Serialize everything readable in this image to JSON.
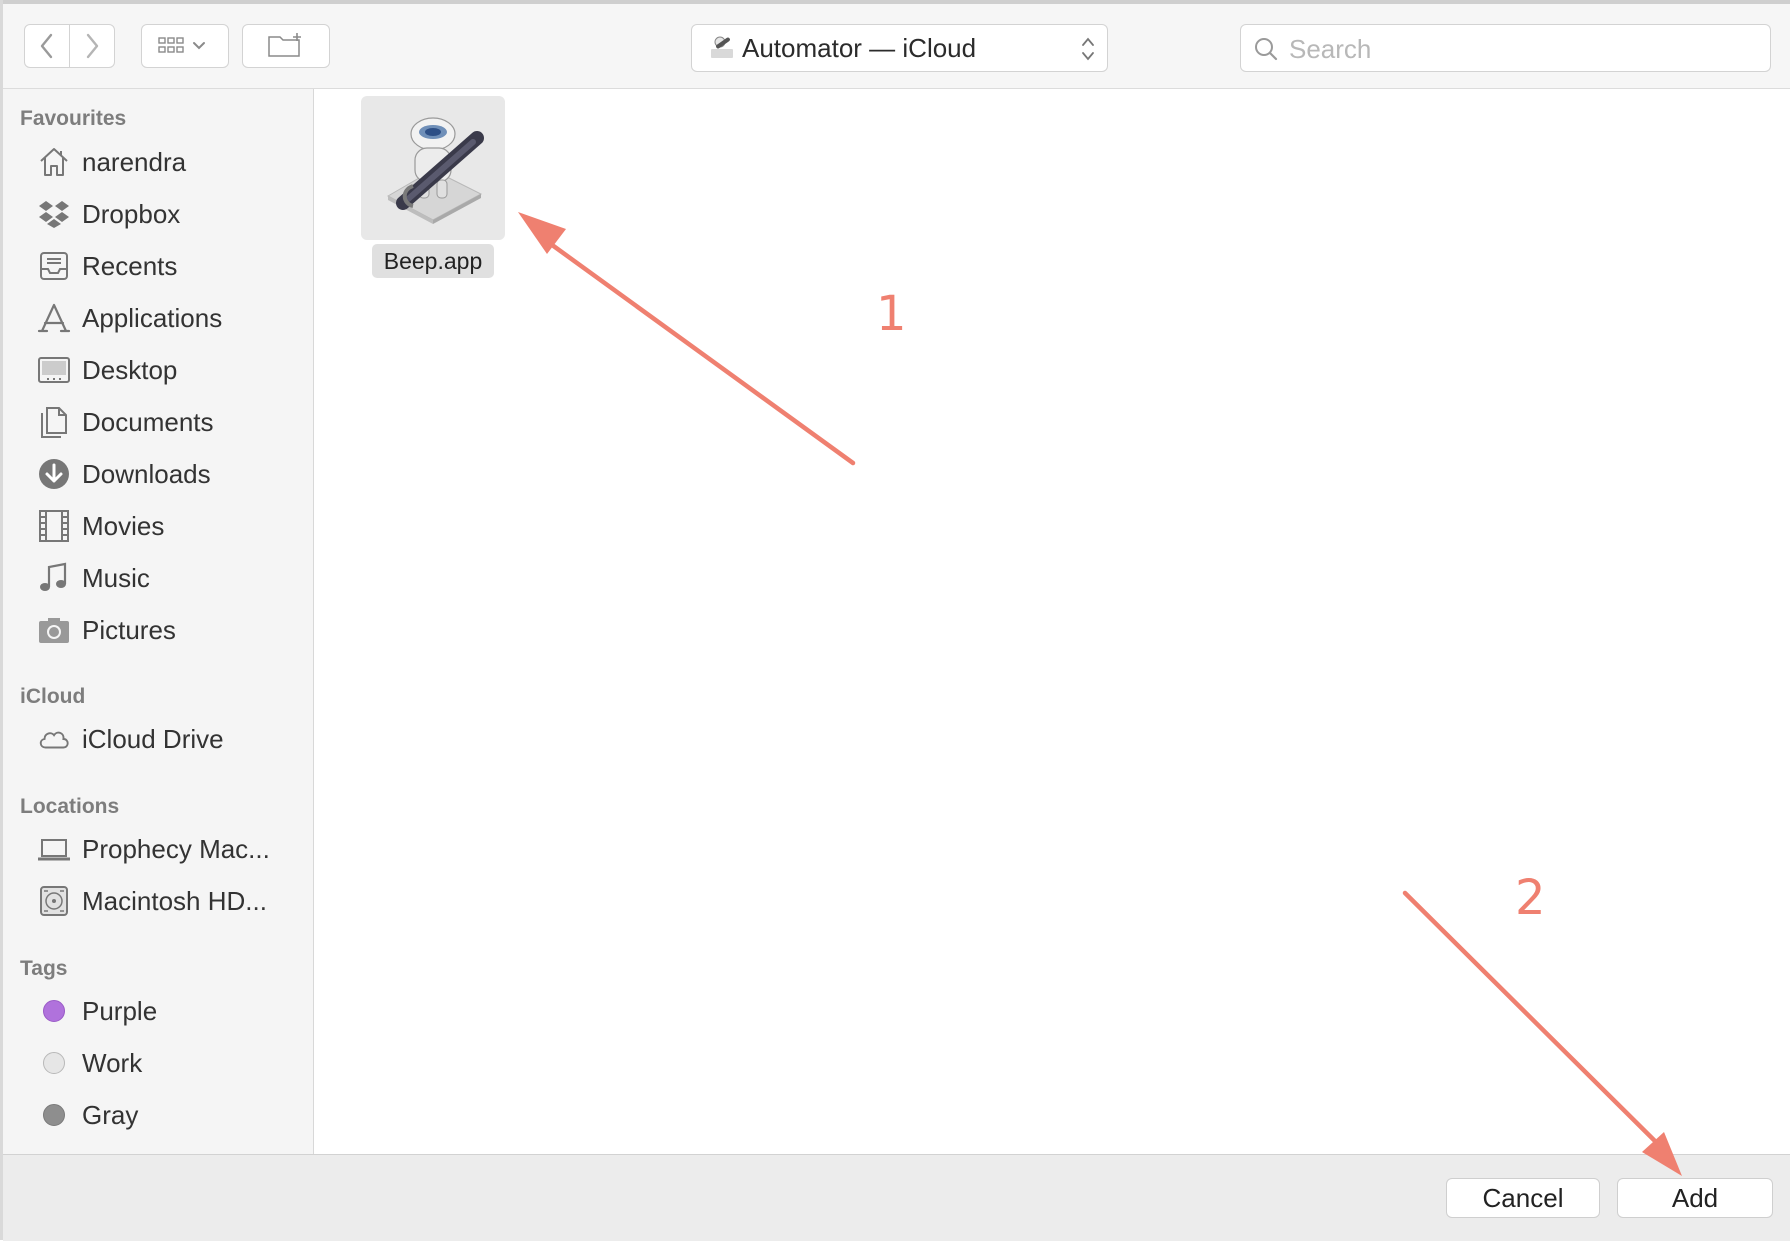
{
  "toolbar": {
    "location": "Automator — iCloud",
    "search_placeholder": "Search"
  },
  "sidebar": {
    "favourites_header": "Favourites",
    "favourites": [
      {
        "label": "narendra",
        "icon": "home-icon"
      },
      {
        "label": "Dropbox",
        "icon": "dropbox-icon"
      },
      {
        "label": "Recents",
        "icon": "recents-icon"
      },
      {
        "label": "Applications",
        "icon": "applications-icon"
      },
      {
        "label": "Desktop",
        "icon": "desktop-icon"
      },
      {
        "label": "Documents",
        "icon": "documents-icon"
      },
      {
        "label": "Downloads",
        "icon": "downloads-icon"
      },
      {
        "label": "Movies",
        "icon": "movies-icon"
      },
      {
        "label": "Music",
        "icon": "music-icon"
      },
      {
        "label": "Pictures",
        "icon": "pictures-icon"
      }
    ],
    "icloud_header": "iCloud",
    "icloud": [
      {
        "label": "iCloud Drive",
        "icon": "cloud-icon"
      }
    ],
    "locations_header": "Locations",
    "locations": [
      {
        "label": "Prophecy Mac...",
        "icon": "laptop-icon"
      },
      {
        "label": "Macintosh HD...",
        "icon": "hard-drive-icon"
      }
    ],
    "tags_header": "Tags",
    "tags": [
      {
        "label": "Purple",
        "color": "#b072dc"
      },
      {
        "label": "Work",
        "color": "#e6e6e6"
      },
      {
        "label": "Gray",
        "color": "#8e8e8e"
      }
    ]
  },
  "content": {
    "files": [
      {
        "name": "Beep.app",
        "icon": "automator-robot-icon"
      }
    ]
  },
  "annotations": {
    "label_1": "1",
    "label_2": "2",
    "color": "#ef8070"
  },
  "footer": {
    "cancel_label": "Cancel",
    "add_label": "Add"
  }
}
